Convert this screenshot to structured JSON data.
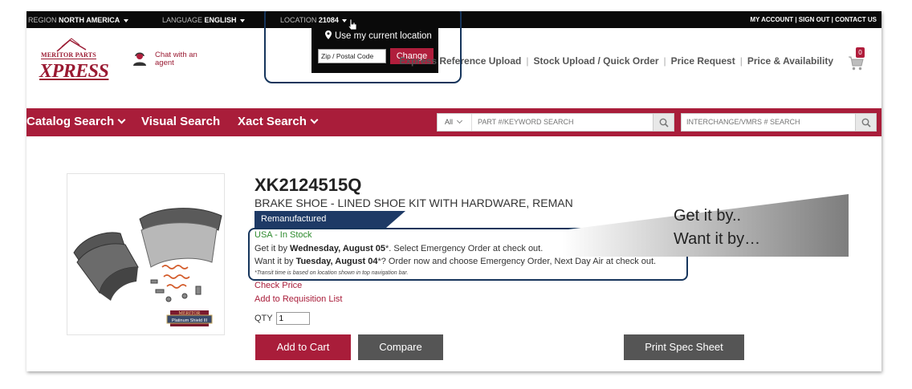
{
  "topbar": {
    "region_label": "REGION",
    "region_value": "NORTH AMERICA",
    "language_label": "LANGUAGE",
    "language_value": "ENGLISH",
    "location_label": "LOCATION",
    "location_value": "21084",
    "account_links": "MY ACCOUNT | SIGN OUT | CONTACT US"
  },
  "location_popup": {
    "use_current": "Use my current location",
    "zip_placeholder": "Zip / Postal Code",
    "change_label": "Change"
  },
  "header": {
    "logo_top": "MERITOR PARTS",
    "logo_main": "XPRESS",
    "chat_label": "Chat with an agent",
    "links": [
      "Express Reference Upload",
      "Stock Upload / Quick Order",
      "Price Request",
      "Price & Availability"
    ],
    "cart_count": "0"
  },
  "nav": {
    "catalog_search": "Catalog Search",
    "visual_search": "Visual Search",
    "xact_search": "Xact Search",
    "search_scope": "All",
    "part_search_placeholder": "PART #/KEYWORD SEARCH",
    "interchange_placeholder": "INTERCHANGE/VMRS # SEARCH"
  },
  "product": {
    "sku": "XK2124515Q",
    "description": "BRAKE SHOE - LINED SHOE KIT WITH HARDWARE, REMAN",
    "condition_badge": "Remanufactured",
    "stock_status": "USA - In Stock",
    "get_it_prefix": "Get it by ",
    "get_it_date": "Wednesday, August 05",
    "get_it_suffix": "*. Select Emergency Order at check out.",
    "want_it_prefix": "Want it by ",
    "want_it_date": "Tuesday, August 04",
    "want_it_suffix": "*? Order now and choose Emergency Order, Next Day Air at check out.",
    "transit_note": "*Transit time is based on location shown in top navigation bar.",
    "check_price": "Check Price",
    "add_requisition": "Add to Requisition List",
    "qty_label": "QTY",
    "qty_value": "1",
    "image_brand": "MERITOR",
    "image_product_line": "Platinum Shield III"
  },
  "buttons": {
    "add_to_cart": "Add to Cart",
    "compare": "Compare",
    "print_spec": "Print Spec Sheet"
  },
  "callout": {
    "line1": "Get it by..",
    "line2": "Want it by…"
  },
  "colors": {
    "brand_red": "#a91d3a",
    "highlight_navy": "#16355c",
    "stock_green": "#2e8b2e",
    "badge_blue": "#1e3a66"
  }
}
